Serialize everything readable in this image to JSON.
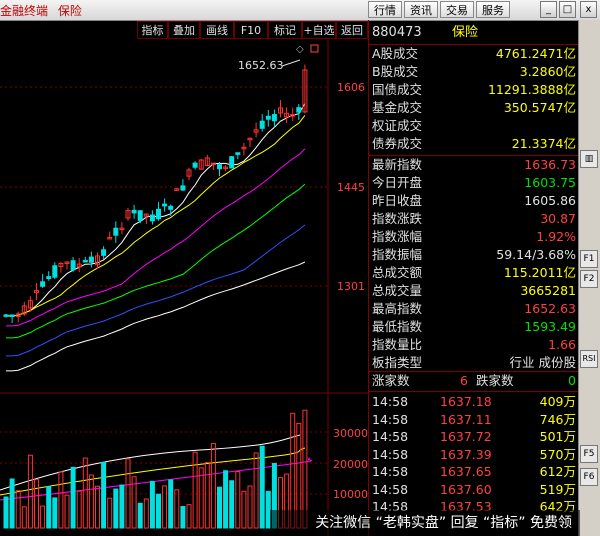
{
  "title_bar": {
    "app_name": "金融终端",
    "section": "保险"
  },
  "top_menu": [
    "行情",
    "资讯",
    "交易",
    "服务"
  ],
  "window_controls": {
    "minimize": "_",
    "restore": "□",
    "close": "x"
  },
  "toolbar": [
    "指标",
    "叠加",
    "画线",
    "F10",
    "标记",
    "+自选",
    "返回"
  ],
  "chart": {
    "price_ticks": [
      "1606",
      "1445",
      "1301"
    ],
    "high_annotation": "1652.63",
    "volume_ticks": [
      "30000",
      "20000",
      "10000"
    ],
    "colors": {
      "up": "#ff3232",
      "down": "#00e0e0",
      "ma5": "#ffffff",
      "ma10": "#ffff00",
      "ma20": "#ff00ff",
      "ma30": "#00ff00",
      "ma60": "#3050ff",
      "ma120": "#ffffff"
    }
  },
  "chart_data": {
    "type": "candlestick",
    "yaxis_ticks": [
      1606,
      1445,
      1301
    ],
    "max_price": 1652.63,
    "volume_ticks": [
      30000,
      20000,
      10000
    ]
  },
  "panel": {
    "code": "880473",
    "name": "保险",
    "turnover": [
      {
        "label": "A股成交",
        "value": "4761.2471亿"
      },
      {
        "label": "B股成交",
        "value": "3.2860亿"
      },
      {
        "label": "国债成交",
        "value": "11291.3888亿"
      },
      {
        "label": "基金成交",
        "value": "350.5747亿"
      },
      {
        "label": "权证成交",
        "value": ""
      },
      {
        "label": "债券成交",
        "value": "21.3374亿"
      }
    ],
    "stats": [
      {
        "label": "最新指数",
        "value": "1636.73",
        "color": "#ff4040"
      },
      {
        "label": "今日开盘",
        "value": "1603.75",
        "color": "#00e000"
      },
      {
        "label": "昨日收盘",
        "value": "1605.86",
        "color": "#e0e0e0"
      },
      {
        "label": "指数涨跌",
        "value": "30.87",
        "color": "#ff4040"
      },
      {
        "label": "指数涨幅",
        "value": "1.92%",
        "color": "#ff4040"
      },
      {
        "label": "指数振幅",
        "value": "59.14/3.68%",
        "color": "#e0e0e0"
      },
      {
        "label": "总成交额",
        "value": "115.2011亿",
        "color": "#ffff00"
      },
      {
        "label": "总成交量",
        "value": "3665281",
        "color": "#ffff00"
      },
      {
        "label": "最高指数",
        "value": "1652.63",
        "color": "#ff4040"
      },
      {
        "label": "最低指数",
        "value": "1593.49",
        "color": "#00e000"
      },
      {
        "label": "指数量比",
        "value": "1.66",
        "color": "#ff4040"
      },
      {
        "label": "板指类型",
        "value": "行业 成份股",
        "color": "#e0e0e0"
      }
    ],
    "breadth": {
      "up_label": "涨家数",
      "up_value": "6",
      "down_label": "跌家数",
      "down_value": "0"
    },
    "ticks": [
      {
        "time": "14:58",
        "price": "1637.18",
        "vol": "409万"
      },
      {
        "time": "14:58",
        "price": "1637.11",
        "vol": "746万"
      },
      {
        "time": "14:58",
        "price": "1637.72",
        "vol": "501万"
      },
      {
        "time": "14:58",
        "price": "1637.39",
        "vol": "570万"
      },
      {
        "time": "14:58",
        "price": "1637.65",
        "vol": "612万"
      },
      {
        "time": "14:58",
        "price": "1637.60",
        "vol": "519万"
      },
      {
        "time": "14:58",
        "price": "1637.53",
        "vol": "642万"
      }
    ]
  },
  "side_icons": [
    "F1",
    "F2",
    "RSI",
    "F5",
    "F6"
  ],
  "watermark": "关注微信 “老韩实盘” 回复 “指标” 免费领"
}
